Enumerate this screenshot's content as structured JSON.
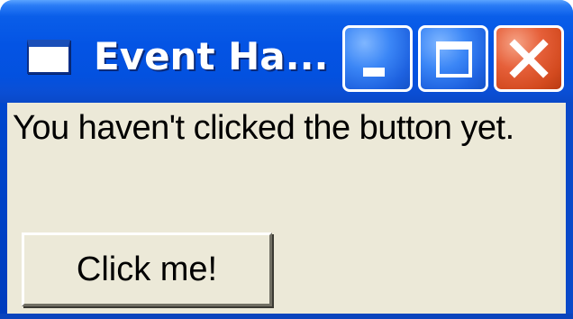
{
  "window": {
    "title": "Event Ha...",
    "controls": {
      "minimize": "minimize",
      "maximize": "maximize",
      "close": "close"
    }
  },
  "content": {
    "status_label": "You haven't clicked the button yet.",
    "button_label": "Click me!"
  },
  "colors": {
    "titlebar": "#0054e3",
    "client_bg": "#ece9d8",
    "close_btn": "#d34a1f"
  },
  "icons": {
    "app_icon": "window-icon",
    "minimize": "minimize-icon",
    "maximize": "maximize-icon",
    "close": "close-icon"
  }
}
